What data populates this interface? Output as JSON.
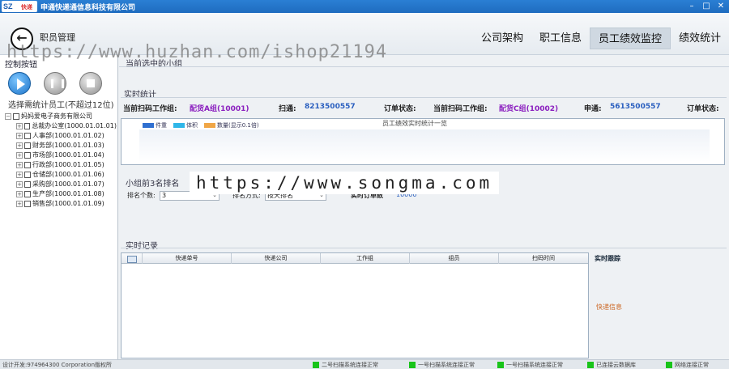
{
  "window": {
    "logo_text": "SZ",
    "logo_sub": "快递",
    "title": "申通快递通信息科技有限公司",
    "controls": [
      "–",
      "□",
      "✕"
    ]
  },
  "header": {
    "page_name": "职员管理",
    "nav": [
      {
        "label": "公司架构",
        "active": false
      },
      {
        "label": "职工信息",
        "active": false
      },
      {
        "label": "员工绩效监控",
        "active": true
      },
      {
        "label": "绩效统计",
        "active": false
      }
    ]
  },
  "watermarks": {
    "top": "https://www.huzhan.com/ishop21194",
    "middle": "https://www.songma.com"
  },
  "left_panel": {
    "title": "控制按钮",
    "hint": "选择需统计员工(不超过12位)",
    "tree_root": "妈妈爱电子商务有限公司",
    "tree_children": [
      "总裁办公室(1000.01.01.01)",
      "人事部(1000.01.01.02)",
      "财务部(1000.01.01.03)",
      "市场部(1000.01.01.04)",
      "行政部(1000.01.01.05)",
      "仓储部(1000.01.01.06)",
      "采购部(1000.01.01.07)",
      "生产部(1000.01.01.08)",
      "销售部(1000.01.01.09)"
    ]
  },
  "main": {
    "current_group_title": "当前选中的小组",
    "realtime_stats_title": "实时统计",
    "stats": {
      "group_label_1": "当前扫码工作组:",
      "group_value_1": "配货A组(10001)",
      "scan_label_1": "扫通:",
      "scan_value_1": "8213500557",
      "order_status_label_1": "订单状态:",
      "group_label_2": "当前扫码工作组:",
      "group_value_2": "配货C组(10002)",
      "scan_label_2": "申通:",
      "scan_value_2": "5613500557",
      "order_status_label_2": "订单状态:"
    },
    "chart": {
      "title": "员工绩效实时统计一览",
      "legend": [
        {
          "label": "件重",
          "color": "#2f6fd0"
        },
        {
          "label": "体积",
          "color": "#2fb6e8"
        },
        {
          "label": "数量(显示0.1倍)",
          "color": "#f0a646"
        }
      ]
    },
    "rank": {
      "title": "小组前3名排名",
      "count_label": "排名个数:",
      "count_value": "3",
      "method_label": "排名方式:",
      "method_value": "按天排名",
      "realtime_orders_label": "实时订单数",
      "realtime_orders_value": "10000"
    },
    "records": {
      "title": "实时记录",
      "columns": [
        "快递单号",
        "快递公司",
        "工作组",
        "组员",
        "扫码时间"
      ],
      "side_title": "实时跟踪",
      "side_express": "快递信息"
    }
  },
  "status_bar": {
    "left": "设计开发:974964300 Corporation版权所",
    "items": [
      "二号扫描系统连接正常",
      "一号扫描系统连接正常",
      "一号扫描系统连接正常",
      "已连接云数据库",
      "网络连接正常"
    ],
    "status_color": "#19c41a"
  }
}
